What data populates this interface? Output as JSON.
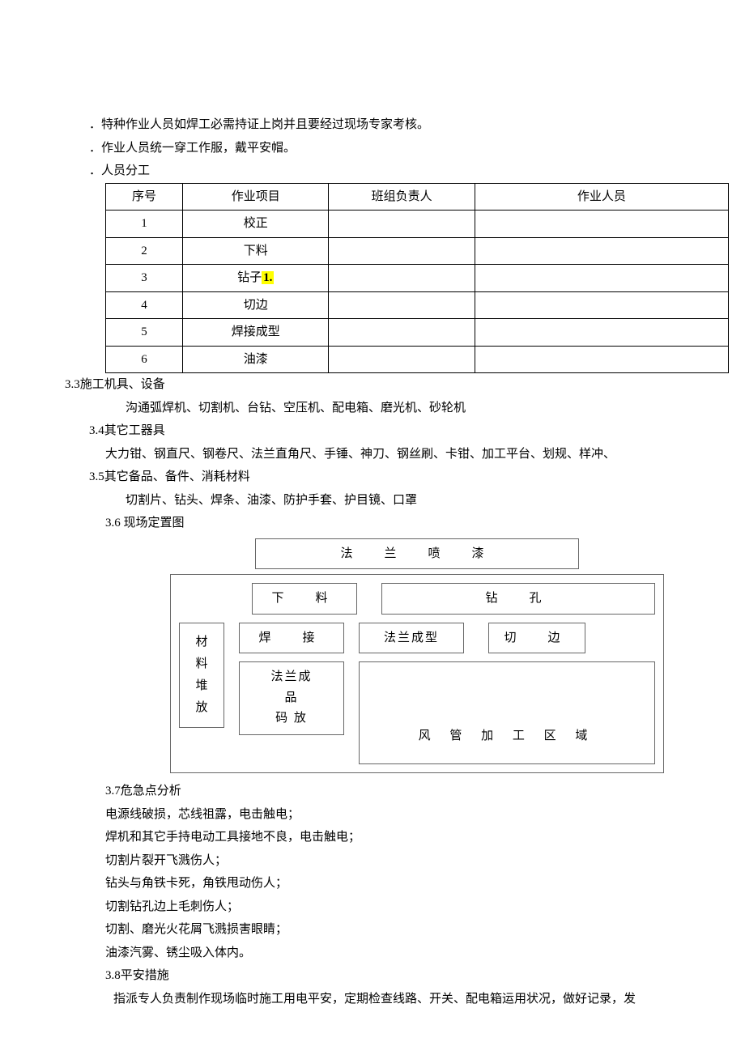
{
  "lines": {
    "l1": "．特种作业人员如焊工必需持证上岗并且要经过现场专家考核。",
    "l2": "．作业人员统一穿工作服，戴平安帽。",
    "l3": "．人员分工"
  },
  "table": {
    "headers": {
      "c1": "序号",
      "c2": "作业项目",
      "c3": "班组负责人",
      "c4": "作业人员"
    },
    "rows": [
      {
        "n": "1",
        "item": "校正",
        "lead": "",
        "staff": ""
      },
      {
        "n": "2",
        "item": "下料",
        "lead": "",
        "staff": ""
      },
      {
        "n": "3",
        "item_pre": "钻子",
        "item_hl": "1.",
        "lead": "",
        "staff": ""
      },
      {
        "n": "4",
        "item": "切边",
        "lead": "",
        "staff": ""
      },
      {
        "n": "5",
        "item": "焊接成型",
        "lead": "",
        "staff": ""
      },
      {
        "n": "6",
        "item": "油漆",
        "lead": "",
        "staff": ""
      }
    ]
  },
  "s33_title": "3.3施工机具、设备",
  "s33_body": "沟通弧焊机、切割机、台钻、空压机、配电箱、磨光机、砂轮机",
  "s34_title": "3.4其它工器具",
  "s34_body": "大力钳、钢直尺、钢卷尺、法兰直角尺、手锤、神刀、钢丝刷、卡钳、加工平台、划规、样冲、",
  "s35_title": "3.5其它备品、备件、消耗材料",
  "s35_body": "切割片、钻头、焊条、油漆、防护手套、护目镜、口罩",
  "s36_title": "3.6 现场定置图",
  "diagram": {
    "spray": "法　兰　喷　漆",
    "cut": "下　料",
    "drill": "钻　孔",
    "mat": "材料堆放",
    "weld": "焊　接",
    "form": "法兰成型",
    "trim": "切　边",
    "stack_l1": "法兰成",
    "stack_l2": "品",
    "stack_l3": "码 放",
    "duct": "风 管 加 工 区 域"
  },
  "s37_title": "3.7危急点分析",
  "s37": {
    "a": "电源线破损，芯线祖露，电击触电；",
    "b": "焊机和其它手持电动工具接地不良，电击触电；",
    "c": "切割片裂开飞溅伤人；",
    "d": "钻头与角铁卡死，角铁甩动伤人；",
    "e": "切割钻孔边上毛刺伤人；",
    "f": "切割、磨光火花屑飞溅损害眼睛；",
    "g": "油漆汽雾、锈尘吸入体内。"
  },
  "s38_title": "3.8平安措施",
  "s38_body": "指派专人负责制作现场临时施工用电平安，定期检查线路、开关、配电箱运用状况，做好记录，发"
}
